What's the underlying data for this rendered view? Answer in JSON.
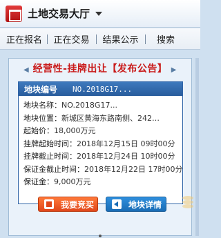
{
  "app": {
    "title": "土地交易大厅",
    "dropdown_icon": "chevron-down-icon"
  },
  "nav": {
    "items": [
      {
        "label": "正在报名"
      },
      {
        "label": "正在交易"
      },
      {
        "label": "结果公示"
      },
      {
        "label": "搜索"
      }
    ]
  },
  "notice": {
    "title": "经营性-挂牌出让【发布公告】",
    "card": {
      "head_label": "地块编号",
      "head_value": "NO.2018G17...",
      "rows": [
        {
          "label": "地块名称：",
          "value": "NO.2018G17..."
        },
        {
          "label": "地块位置：",
          "value": "新城区黄海东路南侧、242…"
        },
        {
          "label": "起始价：",
          "value": "18,000万元"
        },
        {
          "label": "挂牌起始时间：",
          "value": "2018年12月15日 09时00分"
        },
        {
          "label": "挂牌截止时间：",
          "value": "2018年12月24日 10时00分"
        },
        {
          "label": "保证金截止时间：",
          "value": "2018年12月22日 17时00分"
        },
        {
          "label": "保证金：",
          "value": "9,000万元"
        }
      ]
    },
    "buttons": {
      "bid_label": "我要竞买",
      "detail_label": "地块详情"
    }
  },
  "colors": {
    "title_red": "#c91a1a",
    "card_blue": "#2f64a7",
    "bid_orange": "#e0461a",
    "detail_blue": "#196cb5"
  }
}
